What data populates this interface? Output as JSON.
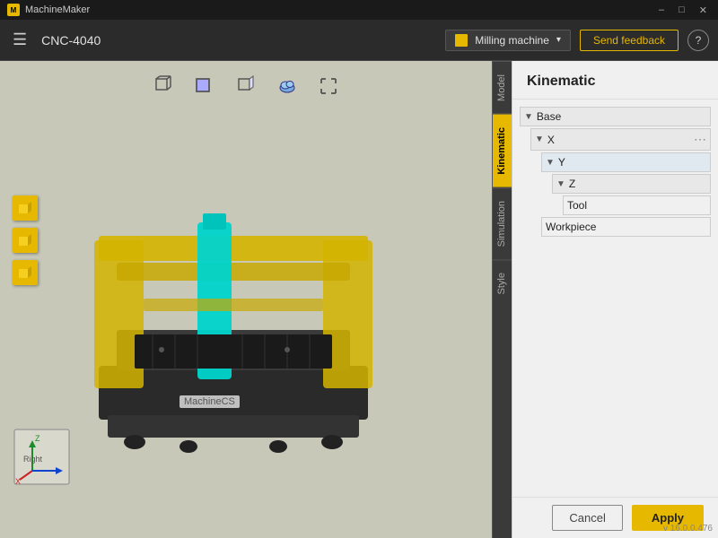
{
  "titlebar": {
    "app_name": "MachineMaker",
    "controls": {
      "minimize": "–",
      "maximize": "□",
      "close": "✕"
    }
  },
  "toolbar": {
    "title": "CNC-4040",
    "machine_selector": {
      "label": "Milling machine",
      "icon": "machine-icon"
    },
    "send_feedback": "Send feedback",
    "help": "?"
  },
  "viewport": {
    "view_buttons": [
      {
        "name": "box-perspective-icon",
        "label": "Perspective"
      },
      {
        "name": "box-front-icon",
        "label": "Front"
      },
      {
        "name": "box-side-icon",
        "label": "Side"
      },
      {
        "name": "cloud-icon",
        "label": "Cloud"
      },
      {
        "name": "fullscreen-icon",
        "label": "Fullscreen"
      }
    ],
    "machine_label": "MachineCS"
  },
  "sidebar": {
    "tabs": [
      {
        "id": "model",
        "label": "Model"
      },
      {
        "id": "kinematic",
        "label": "Kinematic",
        "active": true
      },
      {
        "id": "simulation",
        "label": "Simulation"
      },
      {
        "id": "style",
        "label": "Style"
      }
    ]
  },
  "panel": {
    "title": "Kinematic",
    "tree": [
      {
        "id": "base",
        "label": "Base",
        "level": 0,
        "arrow": "▼",
        "dots": false
      },
      {
        "id": "x",
        "label": "X",
        "level": 1,
        "arrow": "▼",
        "dots": true
      },
      {
        "id": "y",
        "label": "Y",
        "level": 2,
        "arrow": "▼",
        "dots": false
      },
      {
        "id": "z",
        "label": "Z",
        "level": 3,
        "arrow": "▼",
        "dots": false
      },
      {
        "id": "tool",
        "label": "Tool",
        "level": 4,
        "arrow": "",
        "dots": false
      },
      {
        "id": "workpiece",
        "label": "Workpiece",
        "level": 2,
        "arrow": "",
        "dots": false
      }
    ]
  },
  "footer": {
    "cancel_label": "Cancel",
    "apply_label": "Apply",
    "version": "v 16.0.0.476"
  },
  "left_icons": [
    {
      "name": "cube-icon-1"
    },
    {
      "name": "cube-icon-2"
    },
    {
      "name": "cube-icon-3"
    }
  ],
  "coord": {
    "x": "X",
    "y": "Y",
    "z": "Z",
    "label": "Right"
  }
}
